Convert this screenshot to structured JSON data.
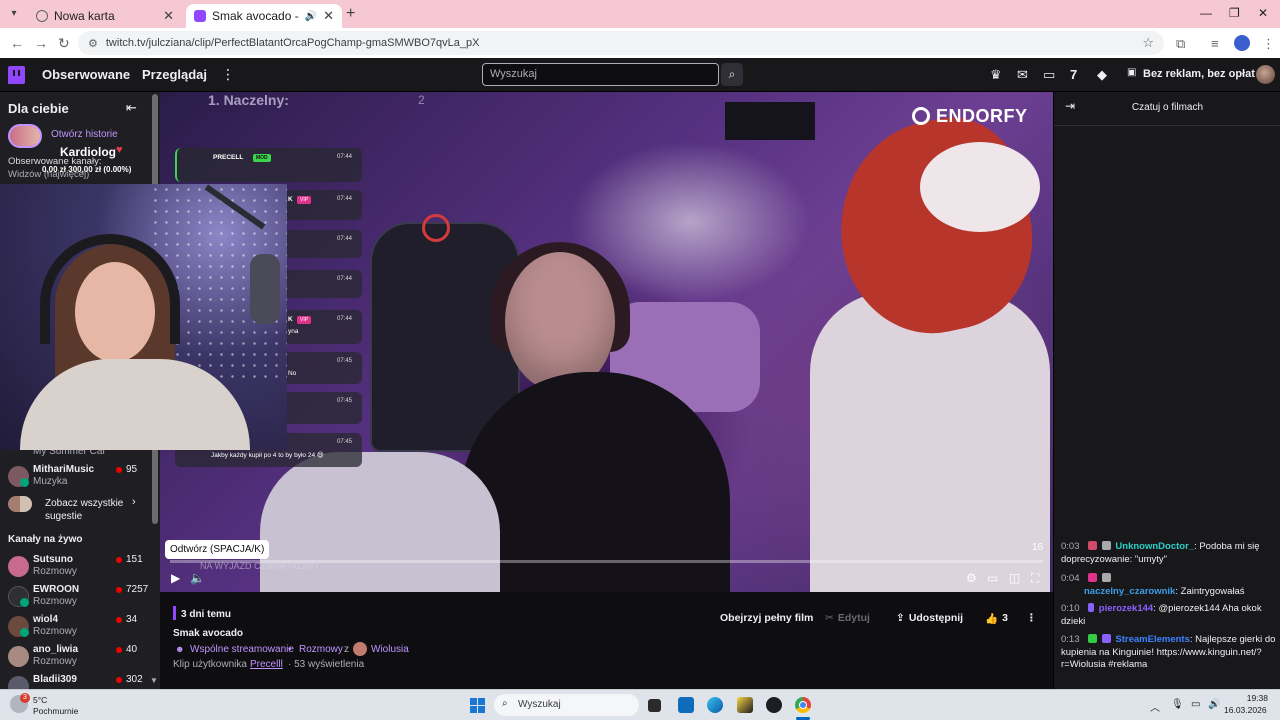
{
  "browser": {
    "tabs": [
      {
        "title": "Nowa karta",
        "favicon_color": "#5f6368"
      },
      {
        "title": "Smak avocado - Twitch",
        "favicon_color": "#9146ff"
      }
    ],
    "url": "twitch.tv/julcziana/clip/PerfectBlatantOrcaPogChamp-gmaSMWBO7qvLa_pX"
  },
  "twitch_nav": {
    "following": "Obserwowane",
    "browse": "Przeglądaj",
    "search_placeholder": "Wyszukaj",
    "no_ads": "Bez reklam, bez opłat"
  },
  "sidebar": {
    "title": "Dla ciebie",
    "stories_link": "Otwórz historie",
    "followed_channels": "Obserwowane kanały:",
    "viewers_sort": "Widzów (najwięcej)",
    "partial_channel": "My Summer Car",
    "recommended": [
      {
        "name": "MithariMusic",
        "category": "Muzyka",
        "viewers": "95",
        "avatar_color": "#7d5a62"
      }
    ],
    "see_all": "Zobacz wszystkie sugestie",
    "live_title": "Kanały na żywo",
    "live": [
      {
        "name": "Sutsuno",
        "category": "Rozmowy",
        "viewers": "151",
        "avatar_color": "#c86a8c"
      },
      {
        "name": "EWROON",
        "category": "Rozmowy",
        "viewers": "7257",
        "avatar_color": "#2e2e33"
      },
      {
        "name": "wiol4",
        "category": "Rozmowy",
        "viewers": "34",
        "avatar_color": "#6b4a3e"
      },
      {
        "name": "ano_liwia",
        "category": "Rozmowy",
        "viewers": "40",
        "avatar_color": "#a88a82"
      },
      {
        "name": "Bladii309",
        "category": "",
        "viewers": "302",
        "avatar_color": "#5a5a6a"
      }
    ]
  },
  "stream_overlay": {
    "ranking_text": "1. Naczelny:",
    "ranking_value": "2",
    "sponsor": "ENDORFY",
    "overlay_user": "Kardiolog",
    "overlay_money": "0,00 zł 300,00 zł (0.00%)",
    "banner": "NA WYJAZD CZWARTKOWY",
    "chat": [
      {
        "name": "PRECELL",
        "badge": "MOD",
        "time": "07:44",
        "text": ""
      },
      {
        "name": "K",
        "badge": "VIP",
        "time": "07:44",
        "text": ""
      },
      {
        "name": "",
        "badge": "",
        "time": "07:44",
        "text": ""
      },
      {
        "name": "",
        "badge": "",
        "time": "07:44",
        "text": ""
      },
      {
        "name": "K",
        "badge": "VIP",
        "time": "07:44",
        "text": "yna"
      },
      {
        "name": "",
        "badge": "",
        "time": "07:45",
        "text": "No"
      },
      {
        "name": "",
        "badge": "",
        "time": "07:45",
        "text": ""
      },
      {
        "name": "",
        "badge": "",
        "time": "07:45",
        "text": "Jakby każdy kupił po 4 to by było 24 😄"
      }
    ]
  },
  "player": {
    "tooltip": "Odtwórz (SPACJA/K)",
    "duration": "16",
    "progress": 0.0
  },
  "clip": {
    "age": "3 dni temu",
    "title": "Smak avocado",
    "coop": "Wspólne streamowanie",
    "category": "Rozmowy",
    "with_label": "z",
    "with_user": "Wiolusia",
    "by_label": "Klip użytkownika",
    "by_user": "Precelll",
    "views": "· 53 wyświetlenia",
    "watch_full": "Obejrzyj pełny film",
    "edit": "Edytuj",
    "share": "Udostępnij",
    "likes": "3"
  },
  "chat_panel": {
    "title": "Czatuj o filmach",
    "messages": [
      {
        "time": "0:03",
        "user": "UnknownDoctor_",
        "text": ": Podoba mi się doprecyzowanie: \"umyty\"",
        "style": "u1",
        "badges": [
          "#d04b6a",
          "#aaaaaa"
        ]
      },
      {
        "time": "0:04",
        "user": "naczelny_czarownik",
        "text": ": Zaintrygowałaś",
        "style": "u2",
        "badges": [
          "#e0348c",
          "#aaaaaa"
        ]
      },
      {
        "time": "0:10",
        "user": "pierozek144",
        "text": ": @pierozek144 Aha okok dzieki",
        "style": "u3",
        "badges": [
          "#8a61ff"
        ]
      },
      {
        "time": "0:13",
        "user": "StreamElements",
        "text": ": Najlepsze gierki do kupienia na Kinguinie! https://www.kinguin.net/?r=Wiolusia #reklama",
        "style": "u4",
        "badges": [
          "#33cc44",
          "#8a61ff"
        ]
      }
    ]
  },
  "taskbar": {
    "weather_temp": "5°C",
    "weather_desc": "Pochmurnie",
    "weather_badge": "3",
    "search": "Wyszukaj",
    "time": "19:38",
    "date": "16.03.2026"
  }
}
